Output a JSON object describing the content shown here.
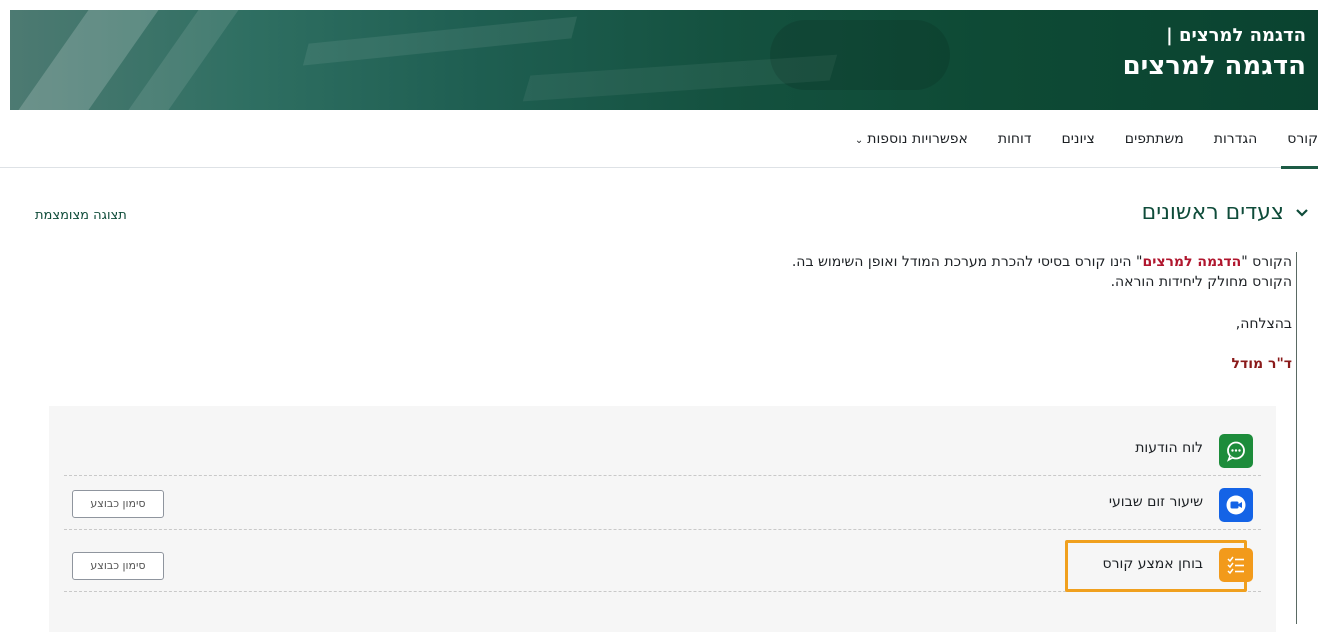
{
  "header": {
    "breadcrumb_title": "הדגמה למרצים |",
    "course_title": "הדגמה למרצים"
  },
  "nav": {
    "items": [
      {
        "label": "קורס",
        "active": true
      },
      {
        "label": "הגדרות"
      },
      {
        "label": "משתתפים"
      },
      {
        "label": "ציונים"
      },
      {
        "label": "דוחות"
      },
      {
        "label": "אפשרויות נוספות"
      }
    ]
  },
  "section": {
    "title": "צעדים ראשונים",
    "collapse_link": "תצוגה מצומצמת",
    "summary_prefix": "הקורס \"",
    "summary_highlight": "הדגמה למרצים",
    "summary_suffix": "\" הינו קורס בסיסי להכרת מערכת המודל ואופן השימוש בה.",
    "summary_line2": "הקורס מחולק ליחידות הוראה.",
    "greeting": "בהצלחה,",
    "signature": "ד\"ר מודל"
  },
  "activities": [
    {
      "name": "לוח הודעות",
      "icon": "chat-icon",
      "icon_color": "#1d8c3b"
    },
    {
      "name": "שיעור זום שבועי",
      "icon": "video-camera-icon",
      "icon_color": "#1463e6",
      "button": "סימון כבוצע"
    },
    {
      "name": "בוחן אמצע קורס",
      "icon": "checklist-icon",
      "icon_color": "#f29a1b",
      "button": "סימון כבוצע",
      "highlighted": true
    }
  ],
  "colors": {
    "brand": "#0f4c3a",
    "highlight": "#f0a01e"
  }
}
